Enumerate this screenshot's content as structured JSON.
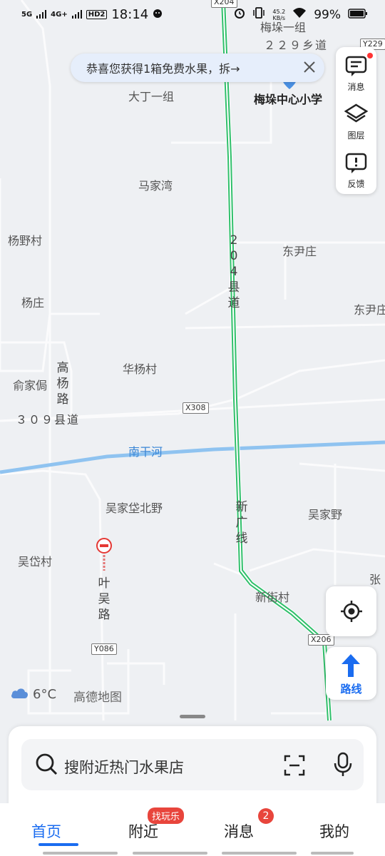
{
  "status": {
    "net1": "5G",
    "net2": "4G+",
    "hd": "HD2",
    "time": "18:14",
    "speed_value": "45.2",
    "speed_unit": "KB/s",
    "battery": "99%"
  },
  "banner": {
    "text": "恭喜您获得1箱免费水果，拆→"
  },
  "tools": {
    "messages": "消息",
    "layers": "图层",
    "feedback": "反馈"
  },
  "map": {
    "labels": {
      "meiduo_group1": "梅垛一组",
      "township_road": "２２９乡道",
      "school": "梅垛中心小学",
      "dading": "大丁一组",
      "majiawan": "马家湾",
      "yangye": "杨野村",
      "dongyin": "东尹庄",
      "yangzhuang": "杨庄",
      "dongyin2": "东尹庄",
      "huayang": "华杨村",
      "yujiadai": "俞家侷",
      "county_road_309": "３０９县道",
      "nanganhe": "南干河",
      "wujiadai_north": "吴家垈北野",
      "wujiaye": "吴家野",
      "wudai": "吴岱村",
      "xinjie": "新街村",
      "zhang": "张",
      "gaoyang_road": "高杨路",
      "yewu_road": "叶吴路",
      "county_road_204": "204县道",
      "xinguang": "新广线"
    },
    "shields": {
      "x204": "X204",
      "y229": "Y229",
      "x308": "X308",
      "x206": "X206",
      "y086": "Y086"
    }
  },
  "weather": {
    "temp": "6°C"
  },
  "brand": "高德地图",
  "route_label": "路线",
  "search": {
    "placeholder": "搜附近热门水果店"
  },
  "nav": {
    "home": "首页",
    "nearby": "附近",
    "nearby_pill": "找玩乐",
    "messages": "消息",
    "messages_badge": "2",
    "mine": "我的"
  }
}
